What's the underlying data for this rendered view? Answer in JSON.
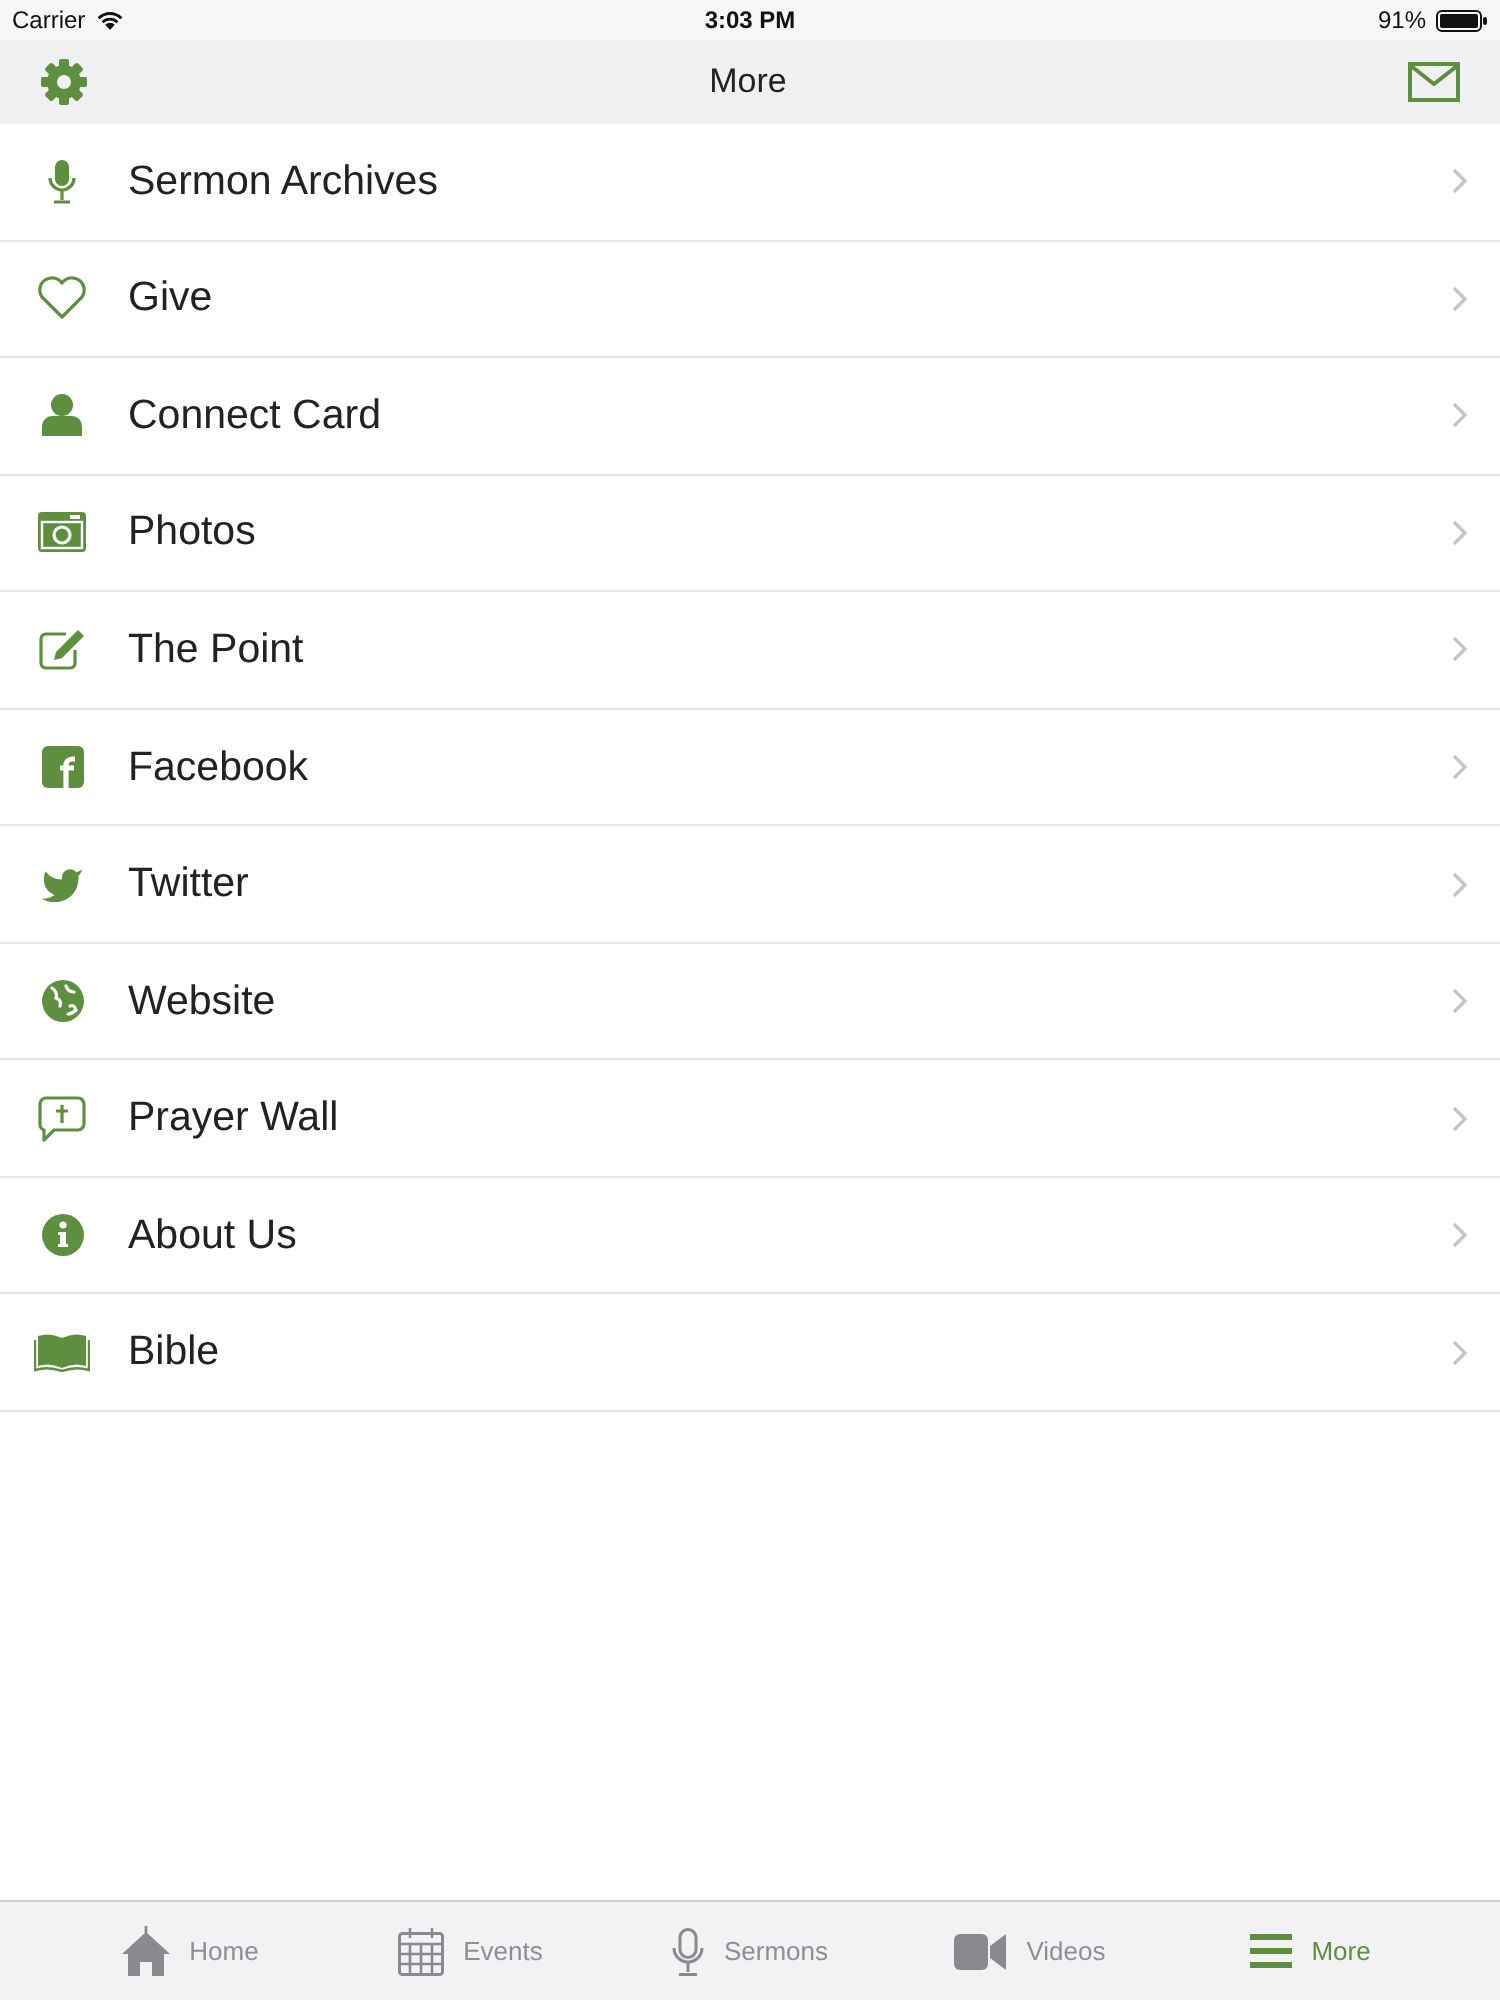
{
  "status_bar": {
    "carrier": "Carrier",
    "time": "3:03 PM",
    "battery": "91%"
  },
  "nav_bar": {
    "title": "More"
  },
  "menu": [
    {
      "label": "Sermon Archives",
      "kind": "mic"
    },
    {
      "label": "Give",
      "kind": "heart"
    },
    {
      "label": "Connect Card",
      "kind": "person"
    },
    {
      "label": "Photos",
      "kind": "camera"
    },
    {
      "label": "The Point",
      "kind": "edit"
    },
    {
      "label": "Facebook",
      "kind": "facebook"
    },
    {
      "label": "Twitter",
      "kind": "twitter"
    },
    {
      "label": "Website",
      "kind": "globe"
    },
    {
      "label": "Prayer Wall",
      "kind": "prayer"
    },
    {
      "label": "About Us",
      "kind": "info"
    },
    {
      "label": "Bible",
      "kind": "book"
    }
  ],
  "tab_bar": [
    {
      "label": "Home",
      "kind": "home",
      "selected": false
    },
    {
      "label": "Events",
      "kind": "calendar",
      "selected": false
    },
    {
      "label": "Sermons",
      "kind": "mic",
      "selected": false
    },
    {
      "label": "Videos",
      "kind": "video",
      "selected": false
    },
    {
      "label": "More",
      "kind": "lines",
      "selected": true
    }
  ]
}
